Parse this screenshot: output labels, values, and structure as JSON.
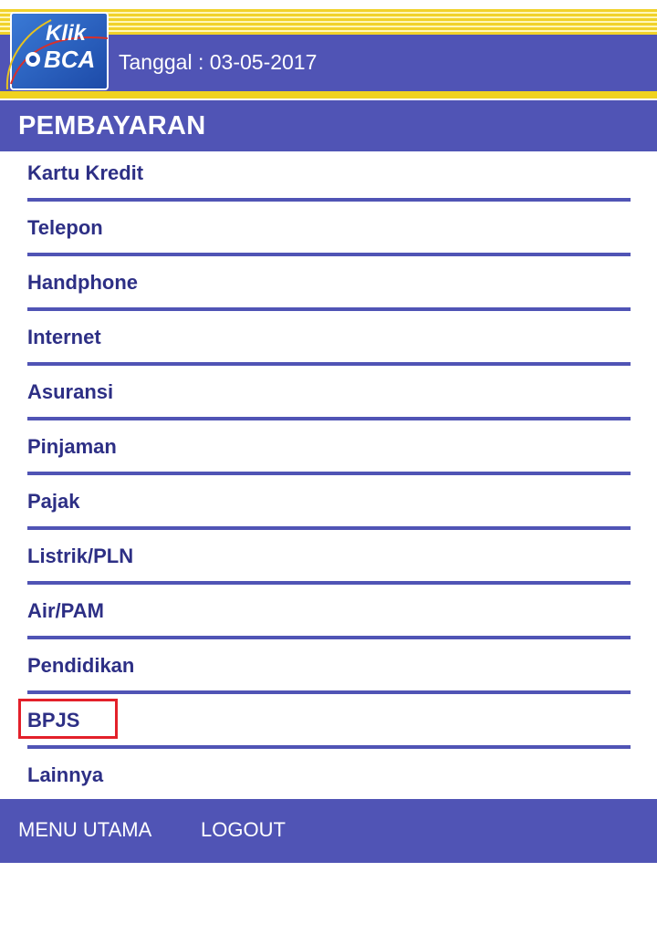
{
  "header": {
    "logo": {
      "line1": "Klik",
      "line2": "BCA"
    },
    "date": "Tanggal : 03-05-2017"
  },
  "section": {
    "title": "PEMBAYARAN"
  },
  "menu": {
    "items": [
      {
        "label": "Kartu Kredit"
      },
      {
        "label": "Telepon"
      },
      {
        "label": "Handphone"
      },
      {
        "label": "Internet"
      },
      {
        "label": "Asuransi"
      },
      {
        "label": "Pinjaman"
      },
      {
        "label": "Pajak"
      },
      {
        "label": "Listrik/PLN"
      },
      {
        "label": "Air/PAM"
      },
      {
        "label": "Pendidikan"
      },
      {
        "label": "BPJS"
      },
      {
        "label": "Lainnya"
      }
    ]
  },
  "footer": {
    "menu_utama": "MENU UTAMA",
    "logout": "LOGOUT"
  },
  "colors": {
    "primary": "#5054b5",
    "accent": "#f0d21f",
    "text": "#2d2f85",
    "highlight": "#e3202a"
  }
}
